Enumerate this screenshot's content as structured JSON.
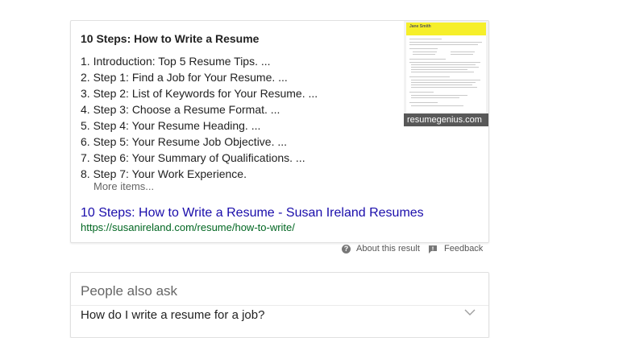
{
  "snippet": {
    "title": "10 Steps: How to Write a Resume",
    "steps": [
      "1. Introduction: Top 5 Resume Tips. ...",
      "2. Step 1: Find a Job for Your Resume. ...",
      "3. Step 2: List of Keywords for Your Resume. ...",
      "4. Step 3: Choose a Resume Format. ...",
      "5. Step 4: Your Resume Heading. ...",
      "6. Step 5: Your Resume Job Objective. ...",
      "7. Step 6: Your Summary of Qualifications. ...",
      "8. Step 7: Your Work Experience."
    ],
    "more_items": "More items...",
    "link_text": "10 Steps: How to Write a Resume - Susan Ireland Resumes",
    "url": "https://susanireland.com/resume/how-to-write/",
    "thumbnail": {
      "caption": "resumegenius.com",
      "resume_name": "Jane Smith",
      "header_color": "#f6ef2a"
    }
  },
  "meta": {
    "about": "About this result",
    "feedback": "Feedback"
  },
  "people_also_ask": {
    "title": "People also ask",
    "questions": [
      "How do I write a resume for a job?"
    ]
  },
  "colors": {
    "link": "#1a0dab",
    "url": "#006621",
    "text": "#222222"
  }
}
